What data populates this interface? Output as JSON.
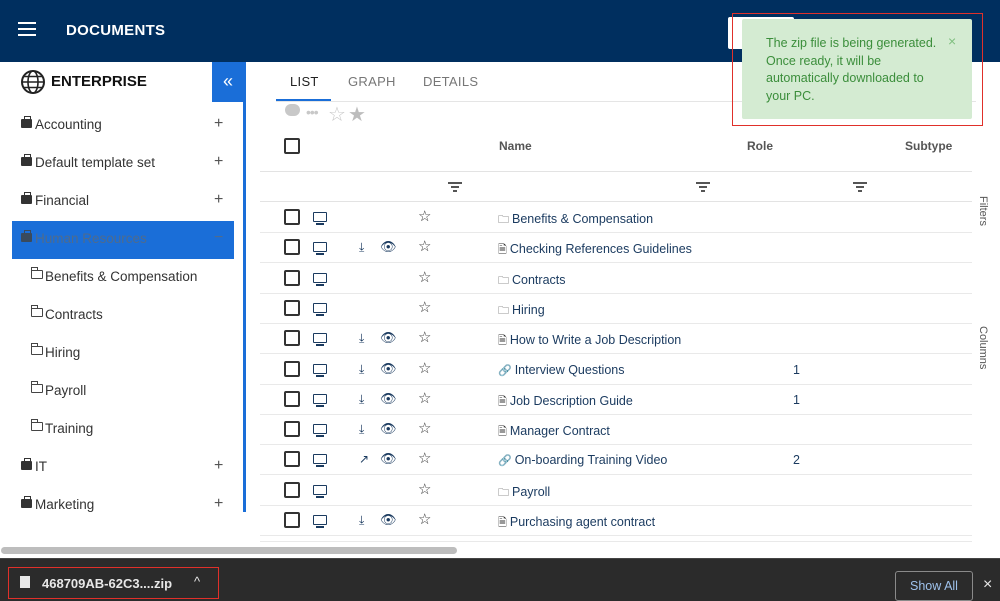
{
  "header": {
    "title": "DOCUMENTS",
    "menu_icon": "hamburger-menu-icon"
  },
  "sidebar": {
    "root_title": "ENTERPRISE",
    "collapse_glyph": "«",
    "plus_glyph": "+",
    "items": [
      {
        "label": "Accounting"
      },
      {
        "label": "Default template set"
      },
      {
        "label": "Financial"
      },
      {
        "label": "Human Resources",
        "selected": true,
        "glyph": "−"
      },
      {
        "label": "IT"
      },
      {
        "label": "Marketing"
      }
    ],
    "subitems": [
      {
        "label": "Benefits & Compensation"
      },
      {
        "label": "Contracts"
      },
      {
        "label": "Hiring"
      },
      {
        "label": "Payroll"
      },
      {
        "label": "Training"
      }
    ]
  },
  "tabs": [
    {
      "label": "LIST",
      "active": true
    },
    {
      "label": "GRAPH"
    },
    {
      "label": "DETAILS"
    }
  ],
  "table": {
    "columns": {
      "name": "Name",
      "role": "Role",
      "subtype": "Subtype"
    },
    "rows": [
      {
        "type": "folder",
        "name": "Benefits & Compensation",
        "role": "",
        "download": false,
        "view": false,
        "external": false
      },
      {
        "type": "pdf",
        "name": "Checking References Guidelines",
        "role": "",
        "download": true,
        "view": true,
        "external": false
      },
      {
        "type": "folder",
        "name": "Contracts",
        "role": "",
        "download": false,
        "view": false,
        "external": false
      },
      {
        "type": "folder",
        "name": "Hiring",
        "role": "",
        "download": false,
        "view": false,
        "external": false
      },
      {
        "type": "pdf",
        "name": "How to Write a Job Description",
        "role": "",
        "download": true,
        "view": true,
        "external": false
      },
      {
        "type": "link",
        "name": "Interview Questions",
        "role": "1",
        "download": true,
        "view": true,
        "external": false
      },
      {
        "type": "doc",
        "name": "Job Description Guide",
        "role": "1",
        "download": true,
        "view": true,
        "external": false
      },
      {
        "type": "doc",
        "name": "Manager Contract",
        "role": "",
        "download": true,
        "view": true,
        "external": false
      },
      {
        "type": "link",
        "name": "On-boarding Training Video",
        "role": "2",
        "download": false,
        "view": true,
        "external": true
      },
      {
        "type": "folder",
        "name": "Payroll",
        "role": "",
        "download": false,
        "view": false,
        "external": false
      },
      {
        "type": "doc",
        "name": "Purchasing agent contract",
        "role": "",
        "download": true,
        "view": true,
        "external": false
      }
    ]
  },
  "side_panel": {
    "filters": "Filters",
    "columns": "Columns"
  },
  "toast": {
    "message": "The zip file is being generated. Once ready, it will be automatically downloaded to your PC.",
    "close_glyph": "×",
    "color": "#3b8e3b"
  },
  "download_bar": {
    "filename": "468709AB-62C3....zip",
    "caret": "^",
    "show_all": "Show All",
    "close_glyph": "×"
  },
  "colors": {
    "header": "#002f5f",
    "accent": "#1a6ed8",
    "highlight": "#e0302a"
  }
}
